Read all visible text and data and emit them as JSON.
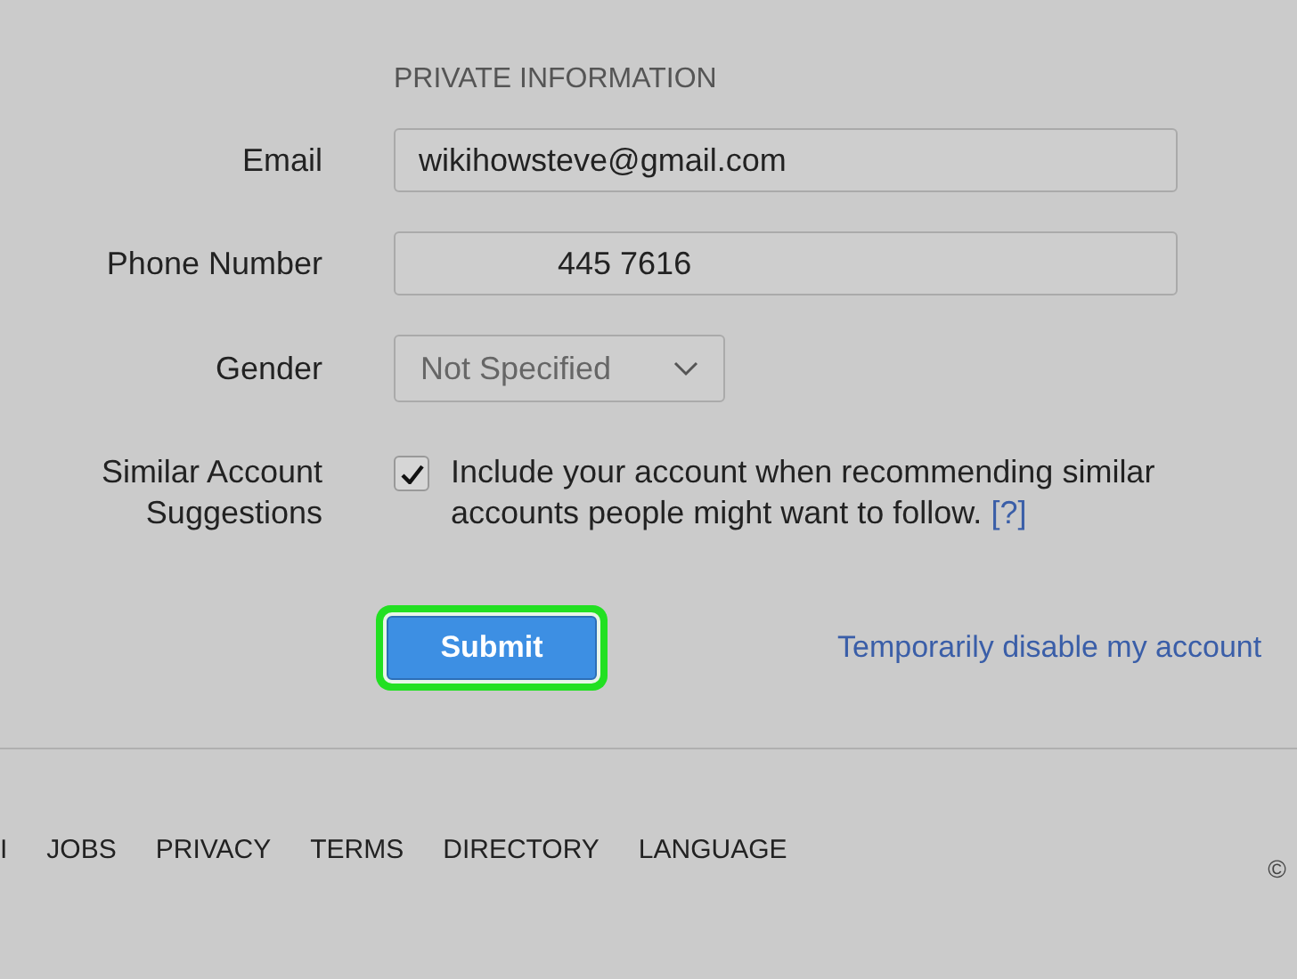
{
  "section_heading": "PRIVATE INFORMATION",
  "fields": [
    {
      "kind": "text",
      "label": "Email",
      "value": "wikihowsteve@gmail.com",
      "indent": false
    },
    {
      "kind": "text",
      "label": "Phone Number",
      "value": "445 7616",
      "indent": true
    },
    {
      "kind": "select",
      "label": "Gender",
      "value": "Not Specified"
    },
    {
      "kind": "checkbox",
      "label": "Similar Account Suggestions",
      "text": "Include your account when recommending similar accounts people might want to follow.",
      "help_link": "[?]",
      "checked": true
    }
  ],
  "submit": {
    "label": "Submit",
    "highlighted": true
  },
  "disable_link": "Temporarily disable my account",
  "footer_links": [
    "I",
    "JOBS",
    "PRIVACY",
    "TERMS",
    "DIRECTORY",
    "LANGUAGE"
  ],
  "copyright": "©"
}
